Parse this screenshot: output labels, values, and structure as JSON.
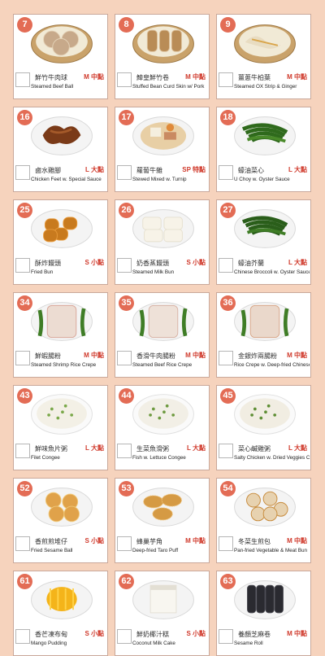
{
  "menu": {
    "items": [
      {
        "number": "7",
        "name_zh": "鮮竹牛肉球",
        "name_en": "Steamed Beef Ball",
        "size": "M 中點",
        "dish": "steamer-balls",
        "colors": [
          "#c7a98a",
          "#e5d3b8"
        ]
      },
      {
        "number": "8",
        "name_zh": "鱆皇鮮竹卷",
        "name_en": "Stuffed Bean Curd Skin w/ Pork",
        "size": "M 中點",
        "dish": "steamer-rolls",
        "colors": [
          "#b98c56",
          "#dcc09a"
        ]
      },
      {
        "number": "9",
        "name_zh": "薑蔥牛柏葉",
        "name_en": "Steamed OX Strip & Ginger",
        "size": "M 中點",
        "dish": "steamer-tripe",
        "colors": [
          "#e8dcc1",
          "#f2ead8"
        ]
      },
      {
        "number": "16",
        "name_zh": "鹵水雞腳",
        "name_en": "Chicken Feet w. Special Sauce",
        "size": "L 大點",
        "dish": "plate-feet",
        "colors": [
          "#7a3a18",
          "#a55a2a"
        ]
      },
      {
        "number": "17",
        "name_zh": "蘿蔔牛雜",
        "name_en": "Stewed Mixed w. Turnip",
        "size": "SP 特點",
        "dish": "bowl-stew",
        "colors": [
          "#c98a62",
          "#e8cfa5"
        ]
      },
      {
        "number": "18",
        "name_zh": "蠔油菜心",
        "name_en": "U Choy w. Oyster Sauce",
        "size": "L 大點",
        "dish": "plate-greens",
        "colors": [
          "#2f6a1c",
          "#4a8a2a"
        ]
      },
      {
        "number": "25",
        "name_zh": "酥炸饅頭",
        "name_en": "Fried Bun",
        "size": "S 小點",
        "dish": "plate-fried-bun",
        "colors": [
          "#c87a1e",
          "#e89a3a"
        ]
      },
      {
        "number": "26",
        "name_zh": "奶香蒸饅頭",
        "name_en": "Steamed Milk Bun",
        "size": "S 小點",
        "dish": "plate-milk-bun",
        "colors": [
          "#f7f3e8",
          "#e6e0cf"
        ]
      },
      {
        "number": "27",
        "name_zh": "蠔油芥蘭",
        "name_en": "Chinese Broccoli w. Oyster Sauce",
        "size": "L 大點",
        "dish": "plate-greens",
        "colors": [
          "#2a5e1a",
          "#3f7d26"
        ]
      },
      {
        "number": "34",
        "name_zh": "鮮蝦腸粉",
        "name_en": "Steamed Shrimp Rice Crepe",
        "size": "M 中點",
        "dish": "plate-crepe",
        "colors": [
          "#ecdcd2",
          "#d9a79a"
        ]
      },
      {
        "number": "35",
        "name_zh": "香滑牛肉腸粉",
        "name_en": "Steamed Beef Rice Crepe",
        "size": "M 中點",
        "dish": "plate-crepe",
        "colors": [
          "#eee1d8",
          "#d8b3a6"
        ]
      },
      {
        "number": "36",
        "name_zh": "金銀炸兩腸粉",
        "name_en": "Rice Crepe w. Deep-fried Chinese Donut",
        "size": "M 中點",
        "dish": "plate-crepe",
        "colors": [
          "#ead8cb",
          "#d9a88a"
        ]
      },
      {
        "number": "43",
        "name_zh": "鮮味魚片粥",
        "name_en": "Filet Congee",
        "size": "L 大點",
        "dish": "bowl-congee",
        "colors": [
          "#f3f0e6",
          "#7aa84a"
        ]
      },
      {
        "number": "44",
        "name_zh": "生菜魚滑粥",
        "name_en": "Fish w. Lettuce Congee",
        "size": "L 大點",
        "dish": "bowl-congee",
        "colors": [
          "#f2efe6",
          "#6e9a40"
        ]
      },
      {
        "number": "45",
        "name_zh": "菜心鹹雞粥",
        "name_en": "Salty Chicken w. Dried Veggies Congee",
        "size": "L 大點",
        "dish": "bowl-congee",
        "colors": [
          "#f1ede2",
          "#5e8e34"
        ]
      },
      {
        "number": "52",
        "name_zh": "香煎煎堆仔",
        "name_en": "Fried Sesame Ball",
        "size": "S 小點",
        "dish": "plate-sesame-balls",
        "colors": [
          "#e0a24a",
          "#f0c878"
        ]
      },
      {
        "number": "53",
        "name_zh": "蜂巢芋角",
        "name_en": "Deep-fried Taro Puff",
        "size": "M 中點",
        "dish": "plate-taro",
        "colors": [
          "#d59a44",
          "#eec27a"
        ]
      },
      {
        "number": "54",
        "name_zh": "冬菜生煎包",
        "name_en": "Pan-fried Vegetable & Meat Bun",
        "size": "M 中點",
        "dish": "plate-pan-bun",
        "colors": [
          "#e7d2b0",
          "#c78a3a"
        ]
      },
      {
        "number": "61",
        "name_zh": "香芒凍布甸",
        "name_en": "Mango Pudding",
        "size": "S 小點",
        "dish": "dessert-mango",
        "colors": [
          "#f4b41a",
          "#ffd34a"
        ]
      },
      {
        "number": "62",
        "name_zh": "鮮奶椰汁糕",
        "name_en": "Coconut Milk Cake",
        "size": "S 小點",
        "dish": "dessert-coconut",
        "colors": [
          "#f8f6f0",
          "#e3dfd4"
        ]
      },
      {
        "number": "63",
        "name_zh": "養顏芝麻卷",
        "name_en": "Sesame Roll",
        "size": "M 中點",
        "dish": "dessert-sesame",
        "colors": [
          "#2a2a30",
          "#4a4a52"
        ]
      }
    ]
  }
}
